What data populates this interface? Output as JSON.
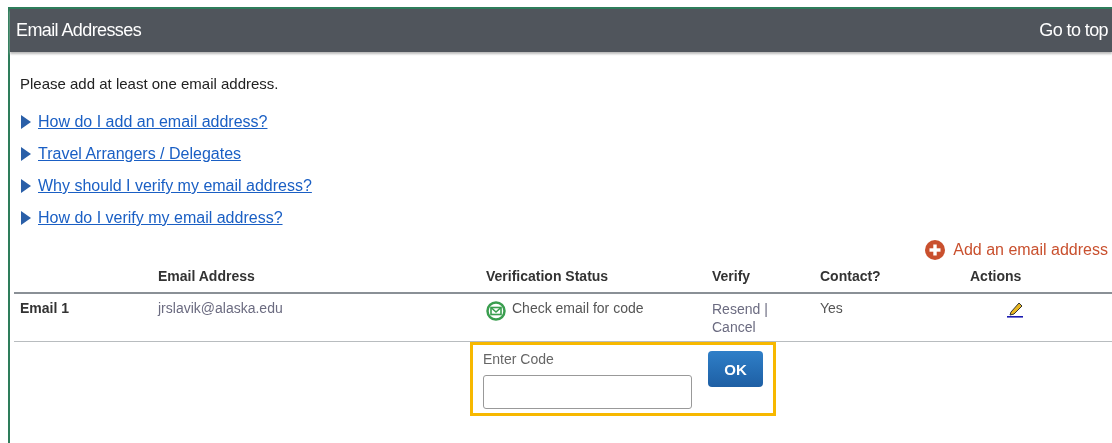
{
  "panel": {
    "title": "Email Addresses",
    "go_to_top": "Go to top"
  },
  "intro": "Please add at least one email address.",
  "help_links": [
    {
      "label": "How do I add an email address?",
      "expanded": false
    },
    {
      "label": "Travel Arrangers / Delegates",
      "expanded": false
    },
    {
      "label": "Why should I verify my email address?",
      "expanded": false
    },
    {
      "label": "How do I verify my email address?",
      "expanded": false
    }
  ],
  "add_link": "Add an email address",
  "table": {
    "columns": [
      "Email Address",
      "Verification Status",
      "Verify",
      "Contact?",
      "Actions"
    ],
    "rows": [
      {
        "label": "Email 1",
        "email": "jrslavik@alaska.edu",
        "status": "Check email for code",
        "verify_links": [
          "Resend",
          "Cancel"
        ],
        "separator": "|",
        "contact": "Yes"
      }
    ]
  },
  "code_entry": {
    "label": "Enter Code",
    "button": "OK"
  }
}
